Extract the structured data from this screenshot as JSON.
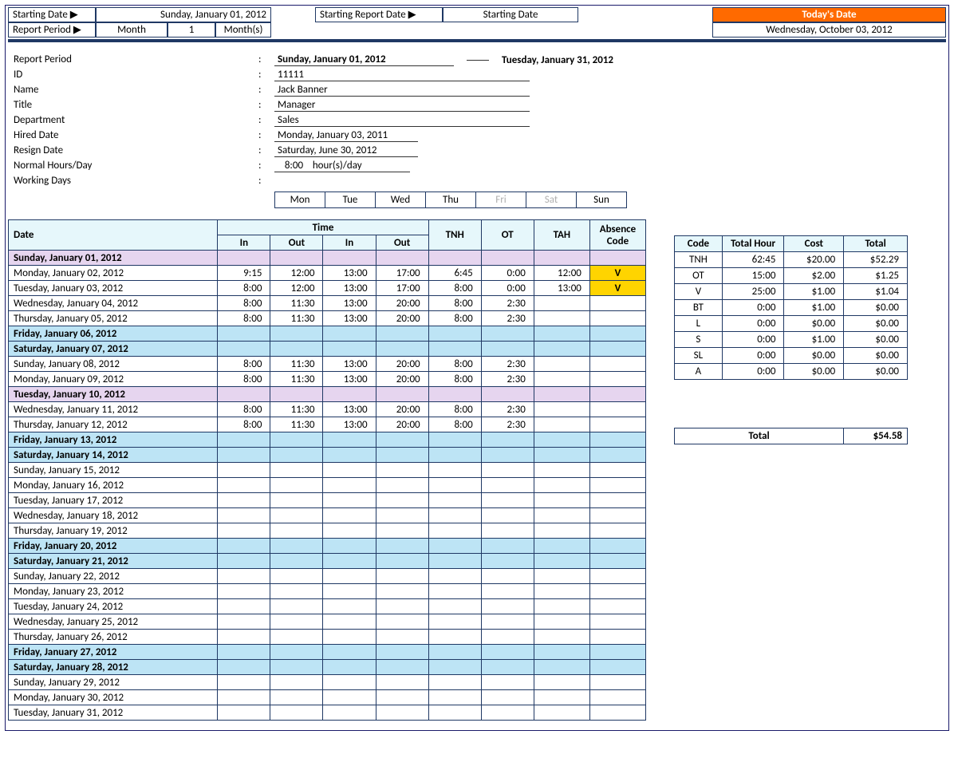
{
  "top": {
    "starting_date_label": "Starting Date ▶",
    "starting_date_value": "Sunday, January 01, 2012",
    "report_period_label": "Report Period ▶",
    "report_period_mode": "Month",
    "report_period_count": "1",
    "report_period_unit": "Month(s)",
    "starting_report_date_label": "Starting Report Date ▶",
    "starting_report_date_value": "Starting Date",
    "today_header": "Today's Date",
    "today_value": "Wednesday, October 03, 2012"
  },
  "info": {
    "report_period_label": "Report Period",
    "report_period_from": "Sunday, January 01, 2012",
    "report_period_to": "Tuesday, January 31, 2012",
    "id_label": "ID",
    "id_value": "11111",
    "name_label": "Name",
    "name_value": "Jack Banner",
    "title_label": "Title",
    "title_value": "Manager",
    "department_label": "Department",
    "department_value": "Sales",
    "hired_label": "Hired Date",
    "hired_value": "Monday, January 03, 2011",
    "resign_label": "Resign Date",
    "resign_value": "Saturday, June 30, 2012",
    "normal_hours_label": "Normal Hours/Day",
    "normal_hours_value": "8:00",
    "normal_hours_unit": "hour(s)/day",
    "working_days_label": "Working Days",
    "days": [
      "Mon",
      "Tue",
      "Wed",
      "Thu",
      "Fri",
      "Sat",
      "Sun"
    ],
    "days_off": [
      false,
      false,
      false,
      false,
      true,
      true,
      false
    ]
  },
  "sheet": {
    "headers": {
      "date": "Date",
      "time": "Time",
      "in": "In",
      "out": "Out",
      "tnh": "TNH",
      "ot": "OT",
      "tah": "TAH",
      "ac": "Absence Code"
    },
    "rows": [
      {
        "date": "Sunday, January 01, 2012",
        "cls": "sun"
      },
      {
        "date": "Monday, January 02, 2012",
        "in1": "9:15",
        "out1": "12:00",
        "in2": "13:00",
        "out2": "17:00",
        "tnh": "6:45",
        "ot": "0:00",
        "tah": "12:00",
        "ac": "V"
      },
      {
        "date": "Tuesday, January 03, 2012",
        "in1": "8:00",
        "out1": "12:00",
        "in2": "13:00",
        "out2": "17:00",
        "tnh": "8:00",
        "ot": "0:00",
        "tah": "13:00",
        "ac": "V"
      },
      {
        "date": "Wednesday, January 04, 2012",
        "in1": "8:00",
        "out1": "11:30",
        "in2": "13:00",
        "out2": "20:00",
        "tnh": "8:00",
        "ot": "2:30"
      },
      {
        "date": "Thursday, January 05, 2012",
        "in1": "8:00",
        "out1": "11:30",
        "in2": "13:00",
        "out2": "20:00",
        "tnh": "8:00",
        "ot": "2:30"
      },
      {
        "date": "Friday, January 06, 2012",
        "cls": "fri"
      },
      {
        "date": "Saturday, January 07, 2012",
        "cls": "sat"
      },
      {
        "date": "Sunday, January 08, 2012",
        "in1": "8:00",
        "out1": "11:30",
        "in2": "13:00",
        "out2": "20:00",
        "tnh": "8:00",
        "ot": "2:30"
      },
      {
        "date": "Monday, January 09, 2012",
        "in1": "8:00",
        "out1": "11:30",
        "in2": "13:00",
        "out2": "20:00",
        "tnh": "8:00",
        "ot": "2:30"
      },
      {
        "date": "Tuesday, January 10, 2012",
        "cls": "sun"
      },
      {
        "date": "Wednesday, January 11, 2012",
        "in1": "8:00",
        "out1": "11:30",
        "in2": "13:00",
        "out2": "20:00",
        "tnh": "8:00",
        "ot": "2:30"
      },
      {
        "date": "Thursday, January 12, 2012",
        "in1": "8:00",
        "out1": "11:30",
        "in2": "13:00",
        "out2": "20:00",
        "tnh": "8:00",
        "ot": "2:30"
      },
      {
        "date": "Friday, January 13, 2012",
        "cls": "fri"
      },
      {
        "date": "Saturday, January 14, 2012",
        "cls": "sat"
      },
      {
        "date": "Sunday, January 15, 2012"
      },
      {
        "date": "Monday, January 16, 2012"
      },
      {
        "date": "Tuesday, January 17, 2012"
      },
      {
        "date": "Wednesday, January 18, 2012"
      },
      {
        "date": "Thursday, January 19, 2012"
      },
      {
        "date": "Friday, January 20, 2012",
        "cls": "fri"
      },
      {
        "date": "Saturday, January 21, 2012",
        "cls": "sat"
      },
      {
        "date": "Sunday, January 22, 2012"
      },
      {
        "date": "Monday, January 23, 2012"
      },
      {
        "date": "Tuesday, January 24, 2012"
      },
      {
        "date": "Wednesday, January 25, 2012"
      },
      {
        "date": "Thursday, January 26, 2012"
      },
      {
        "date": "Friday, January 27, 2012",
        "cls": "fri"
      },
      {
        "date": "Saturday, January 28, 2012",
        "cls": "sat"
      },
      {
        "date": "Sunday, January 29, 2012"
      },
      {
        "date": "Monday, January 30, 2012"
      },
      {
        "date": "Tuesday, January 31, 2012"
      }
    ]
  },
  "summary": {
    "headers": {
      "code": "Code",
      "th": "Total Hour",
      "cost": "Cost",
      "total": "Total"
    },
    "rows": [
      {
        "code": "TNH",
        "th": "62:45",
        "cost": "$20.00",
        "total": "$52.29"
      },
      {
        "code": "OT",
        "th": "15:00",
        "cost": "$2.00",
        "total": "$1.25"
      },
      {
        "code": "V",
        "th": "25:00",
        "cost": "$1.00",
        "total": "$1.04"
      },
      {
        "code": "BT",
        "th": "0:00",
        "cost": "$1.00",
        "total": "$0.00"
      },
      {
        "code": "L",
        "th": "0:00",
        "cost": "$0.00",
        "total": "$0.00"
      },
      {
        "code": "S",
        "th": "0:00",
        "cost": "$1.00",
        "total": "$0.00"
      },
      {
        "code": "SL",
        "th": "0:00",
        "cost": "$0.00",
        "total": "$0.00"
      },
      {
        "code": "A",
        "th": "0:00",
        "cost": "$0.00",
        "total": "$0.00"
      }
    ],
    "grand_label": "Total",
    "grand_value": "$54.58"
  }
}
